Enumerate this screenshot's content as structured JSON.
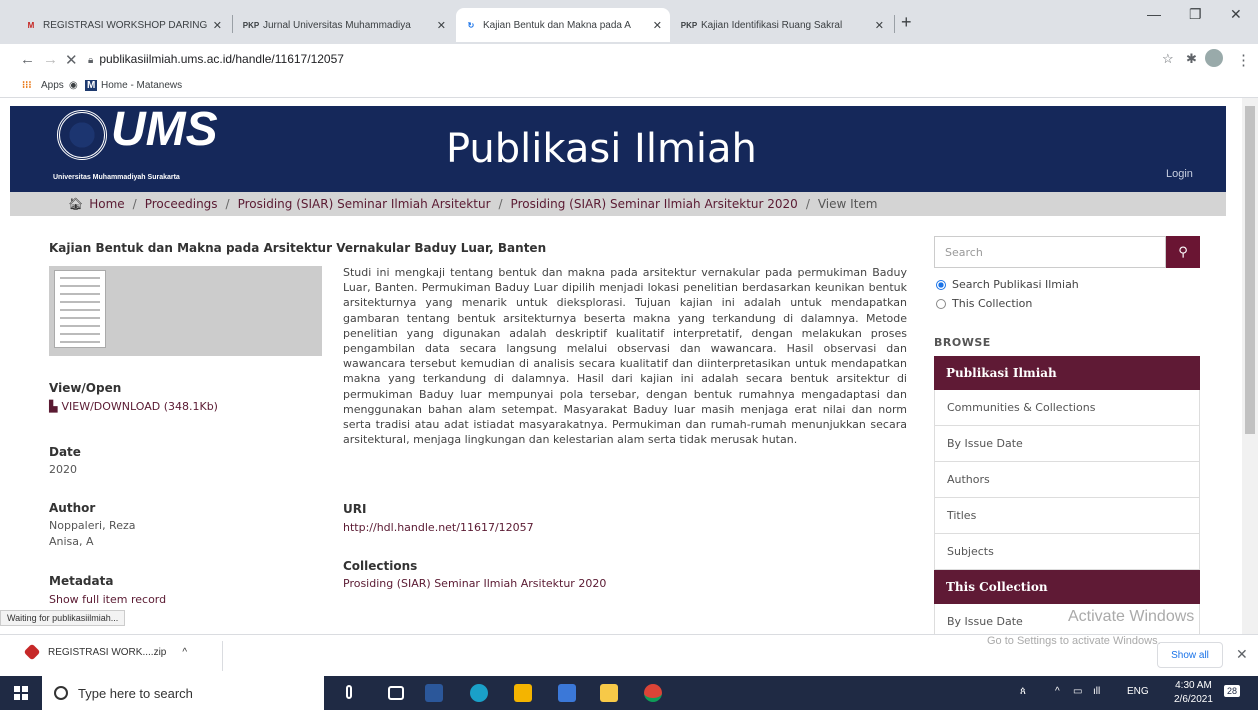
{
  "browser": {
    "tabs": [
      {
        "icon": "M",
        "title": "REGISTRASI WORKSHOP DARING",
        "color": "#c5221f"
      },
      {
        "icon": "PKP",
        "title": "Jurnal Universitas Muhammadiya",
        "color": "#333"
      },
      {
        "icon": "↻",
        "title": "Kajian Bentuk dan Makna pada A",
        "color": "#1a73e8"
      },
      {
        "icon": "PKP",
        "title": "Kajian Identifikasi Ruang Sakral",
        "color": "#333"
      }
    ],
    "url": "publikasiilmiah.ums.ac.id/handle/11617/12057",
    "bookmarks": {
      "apps": "Apps",
      "site": "Home - Matanews"
    }
  },
  "site": {
    "logo_text": "UMS",
    "logo_sub": "Universitas Muhammadiyah Surakarta",
    "title": "Publikasi Ilmiah",
    "login": "Login"
  },
  "breadcrumb": [
    "Home",
    "Proceedings",
    "Prosiding (SIAR) Seminar Ilmiah Arsitektur",
    "Prosiding (SIAR) Seminar Ilmiah Arsitektur 2020",
    "View Item"
  ],
  "item": {
    "title": "Kajian Bentuk dan Makna pada Arsitektur Vernakular Baduy Luar, Banten",
    "view_open_label": "View/Open",
    "download": "VIEW/DOWNLOAD (348.1Kb)",
    "date_label": "Date",
    "date": "2020",
    "author_label": "Author",
    "authors": [
      "Noppaleri, Reza",
      "Anisa, A"
    ],
    "metadata_label": "Metadata",
    "metadata_link": "Show full item record",
    "abstract": "Studi ini mengkaji tentang bentuk dan makna pada arsitektur vernakular pada permukiman Baduy Luar, Banten. Permukiman Baduy Luar dipilih menjadi lokasi penelitian berdasarkan keunikan bentuk arsitekturnya yang menarik untuk dieksplorasi. Tujuan kajian ini adalah untuk mendapatkan gambaran tentang bentuk arsitekturnya beserta makna yang terkandung di dalamnya. Metode penelitian yang digunakan adalah deskriptif kualitatif interpretatif, dengan melakukan proses pengambilan data secara langsung melalui observasi dan wawancara. Hasil observasi dan wawancara tersebut kemudian di analisis secara kualitatif dan diinterpretasikan untuk mendapatkan makna yang terkandung di dalamnya. Hasil dari kajian ini adalah secara bentuk arsitektur di permukiman Baduy luar mempunyai pola tersebar, dengan bentuk rumahnya mengadaptasi dan menggunakan bahan alam setempat. Masyarakat Baduy luar masih menjaga erat nilai dan norm serta tradisi atau adat istiadat masyarakatnya. Permukiman dan rumah-rumah menunjukkan secara arsitektural, menjaga lingkungan dan kelestarian alam serta tidak merusak hutan.",
    "uri_label": "URI",
    "uri": "http://hdl.handle.net/11617/12057",
    "collections_label": "Collections",
    "collection": "Prosiding (SIAR) Seminar Ilmiah Arsitektur 2020"
  },
  "sidebar": {
    "search_placeholder": "Search",
    "radio_all": "Search Publikasi Ilmiah",
    "radio_collection": "This Collection",
    "browse": "BROWSE",
    "section1": "Publikasi Ilmiah",
    "items1": [
      "Communities & Collections",
      "By Issue Date",
      "Authors",
      "Titles",
      "Subjects"
    ],
    "section2": "This Collection",
    "items2": [
      "By Issue Date"
    ]
  },
  "status_text": "Waiting for publikasiilmiah...",
  "watermark": {
    "line1": "Activate Windows",
    "line2": "Go to Settings to activate Windows."
  },
  "download_bar": {
    "file": "REGISTRASI WORK....zip",
    "show_all": "Show all"
  },
  "taskbar": {
    "search": "Type here to search",
    "lang": "ENG",
    "time": "4:30 AM",
    "date": "2/6/2021",
    "notif": "28"
  },
  "colors": {
    "header": "#15285a",
    "accent": "#5f1a35"
  }
}
